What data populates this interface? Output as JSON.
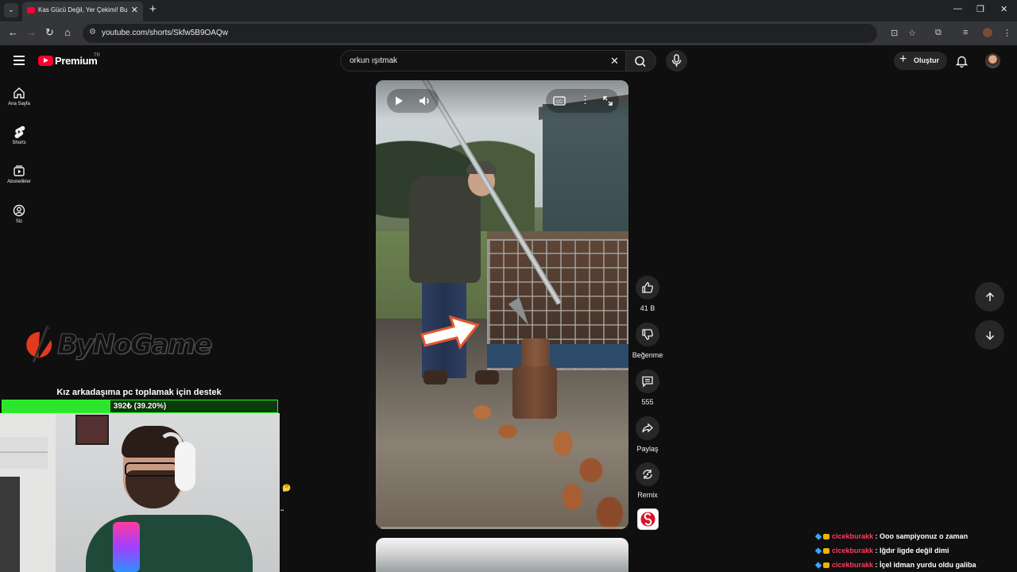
{
  "browser": {
    "tab_title": "Kas Gücü Değil, Yer Çekimi! Bu",
    "url": "youtube.com/shorts/Skfw5B9OAQw"
  },
  "header": {
    "brand": "Premium",
    "region": "TR",
    "search_query": "orkun ışıtmak",
    "create_label": "Oluştur"
  },
  "sidebar": {
    "items": [
      {
        "label": "Ana Sayfa",
        "icon": "home-icon"
      },
      {
        "label": "Shorts",
        "icon": "shorts-icon"
      },
      {
        "label": "Abonelikler",
        "icon": "subscriptions-icon"
      },
      {
        "label": "Siz",
        "icon": "you-icon"
      }
    ]
  },
  "actions": {
    "like_count": "41 B",
    "dislike_label": "Beğenme",
    "comment_count": "555",
    "share_label": "Paylaş",
    "remix_label": "Remix"
  },
  "overlay": {
    "logo_text": "ByNoGame",
    "donation_title": "Kız arkadaşıma pc toplamak için destek",
    "donation_text": "392₺ (39.20%)",
    "donation_progress": 0.392
  },
  "chat": {
    "messages": [
      {
        "user": "cicekburakk",
        "text": "Ooo sampiyonuz o zaman"
      },
      {
        "user": "cicekburakk",
        "text": "Iğdır ligde değil dimi"
      },
      {
        "user": "cicekburakk",
        "text": "İçel idman yurdu oldu galiba"
      }
    ]
  },
  "colors": {
    "accent": "#ff0033",
    "background": "#0f0f0f",
    "donation_green": "#2ee52e",
    "chat_user": "#ff3b5c"
  }
}
